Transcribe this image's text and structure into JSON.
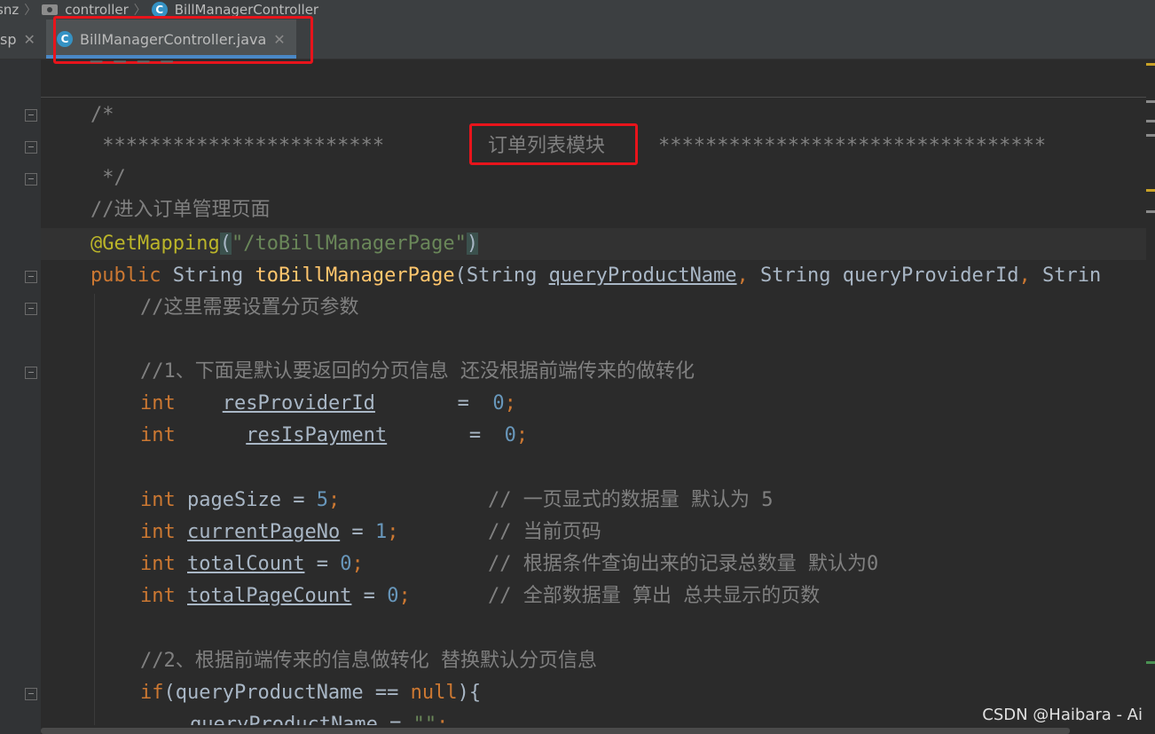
{
  "breadcrumb": {
    "items": [
      "snz",
      "controller",
      "BillManagerController"
    ]
  },
  "tabs": {
    "previous_label": "sp",
    "active_label": "BillManagerController.java",
    "icon_letter": "C"
  },
  "code": {
    "line1_partial": "─ ─ ─ ─",
    "l_comment_open": "/*",
    "l_stars_left": " ************************",
    "l_section_title": "订单列表模块",
    "l_stars_right": "*********************************",
    "l_comment_close": " */",
    "l_comment_enter": "//进入订单管理页面",
    "annotation": "@GetMapping",
    "annotation_arg": "\"/toBillManagerPage\"",
    "public": "public",
    "type_string": "String",
    "method_name": "toBillManagerPage",
    "param1": "queryProductName",
    "param2": "queryProviderId",
    "param3_partial": "Strin",
    "c_set_paging": "//这里需要设置分页参数",
    "c_step1": "//1、下面是默认要返回的分页信息 还没根据前端传来的做转化",
    "int": "int",
    "var_res_provider": "resProviderId",
    "var_res_payment": "resIsPayment",
    "var_page_size": "pageSize",
    "var_current_page": "currentPageNo",
    "var_total_count": "totalCount",
    "var_total_page_count": "totalPageCount",
    "val_zero": "0",
    "val_five": "5",
    "val_one": "1",
    "c_page_size": "// 一页显式的数据量 默认为 5",
    "c_current_page": "// 当前页码",
    "c_total_count": "// 根据条件查询出来的记录总数量 默认为0",
    "c_total_page_count": "// 全部数据量 算出 总共显示的页数",
    "c_step2": "//2、根据前端传来的信息做转化 替换默认分页信息",
    "if": "if",
    "null": "null",
    "empty_string": "\"\""
  },
  "watermark": "CSDN @Haibara - Ai",
  "colors": {
    "highlight_box": "#e8141b",
    "keyword": "#cc7832",
    "number": "#6897bb",
    "comment": "#808080",
    "annotation": "#bbb529",
    "string": "#6a8759",
    "method": "#ffc66d"
  }
}
